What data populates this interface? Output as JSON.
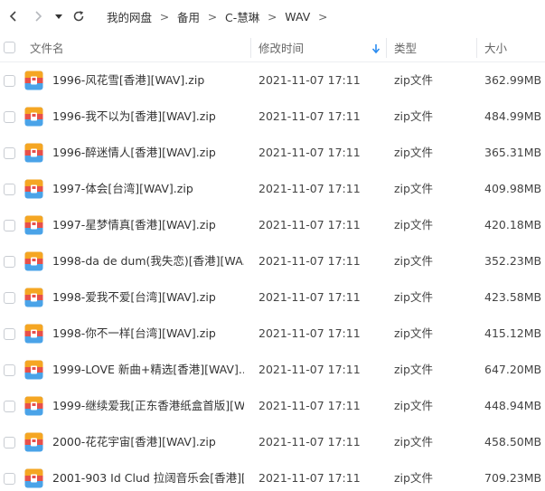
{
  "nav": {
    "back_icon": "chevron-left-icon",
    "forward_icon": "chevron-right-icon",
    "history_icon": "caret-down-icon",
    "refresh_icon": "refresh-icon"
  },
  "breadcrumb": {
    "items": [
      "我的网盘",
      "备用",
      "C-慧琳",
      "WAV"
    ],
    "separator": ">"
  },
  "header": {
    "name": "文件名",
    "modified": "修改时间",
    "type": "类型",
    "size": "大小",
    "sort_icon": "sort-descending-icon",
    "sort_color": "#2b8cf0"
  },
  "files": [
    {
      "name": "1996-风花雪[香港][WAV].zip",
      "modified": "2021-11-07 17:11",
      "type": "zip文件",
      "size": "362.99MB"
    },
    {
      "name": "1996-我不以为[香港][WAV].zip",
      "modified": "2021-11-07 17:11",
      "type": "zip文件",
      "size": "484.99MB"
    },
    {
      "name": "1996-醉迷情人[香港][WAV].zip",
      "modified": "2021-11-07 17:11",
      "type": "zip文件",
      "size": "365.31MB"
    },
    {
      "name": "1997-体会[台湾][WAV].zip",
      "modified": "2021-11-07 17:11",
      "type": "zip文件",
      "size": "409.98MB"
    },
    {
      "name": "1997-星梦情真[香港][WAV].zip",
      "modified": "2021-11-07 17:11",
      "type": "zip文件",
      "size": "420.18MB"
    },
    {
      "name": "1998-da de dum(我失恋)[香港][WA...",
      "modified": "2021-11-07 17:11",
      "type": "zip文件",
      "size": "352.23MB"
    },
    {
      "name": "1998-爱我不爱[台湾][WAV].zip",
      "modified": "2021-11-07 17:11",
      "type": "zip文件",
      "size": "423.58MB"
    },
    {
      "name": "1998-你不一样[台湾][WAV].zip",
      "modified": "2021-11-07 17:11",
      "type": "zip文件",
      "size": "415.12MB"
    },
    {
      "name": "1999-LOVE 新曲+精选[香港][WAV]....",
      "modified": "2021-11-07 17:11",
      "type": "zip文件",
      "size": "647.20MB"
    },
    {
      "name": "1999-继续爱我[正东香港纸盒首版][W...",
      "modified": "2021-11-07 17:11",
      "type": "zip文件",
      "size": "448.94MB"
    },
    {
      "name": "2000-花花宇宙[香港][WAV].zip",
      "modified": "2021-11-07 17:11",
      "type": "zip文件",
      "size": "458.50MB"
    },
    {
      "name": "2001-903 Id Clud 拉阔音乐会[香港][...",
      "modified": "2021-11-07 17:11",
      "type": "zip文件",
      "size": "709.23MB"
    }
  ],
  "file_icon": "zip-archive-icon",
  "colors": {
    "icon_top": "#f5a623",
    "icon_bottom": "#4aa3e8",
    "icon_band": "#e8504a"
  }
}
